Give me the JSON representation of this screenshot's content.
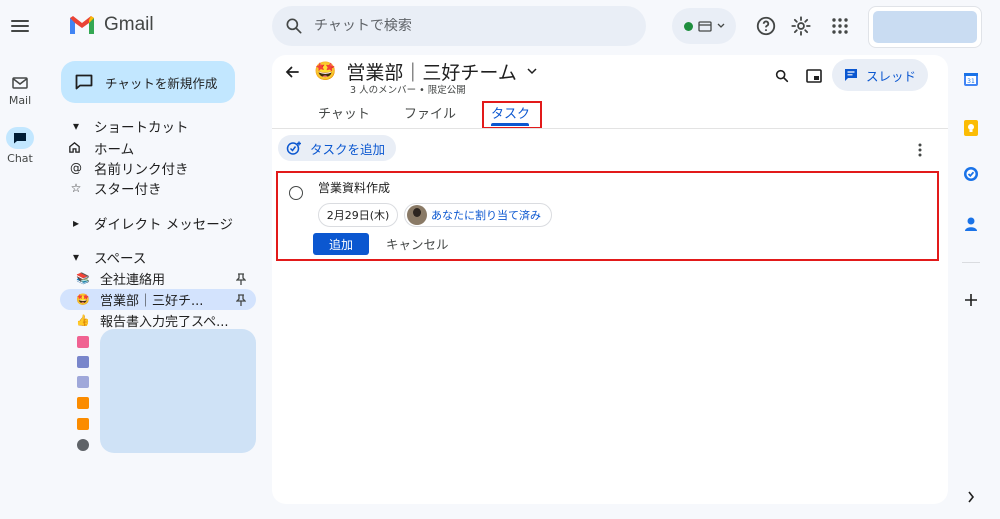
{
  "header": {
    "app_name": "Gmail",
    "search_placeholder": "チャットで検索"
  },
  "rail": {
    "mail_label": "Mail",
    "chat_label": "Chat"
  },
  "sidebar": {
    "new_chat_label": "チャットを新規作成",
    "shortcuts_label": "ショートカット",
    "shortcuts": [
      {
        "label": "ホーム",
        "icon": "home-icon"
      },
      {
        "label": "名前リンク付き",
        "icon": "at-icon"
      },
      {
        "label": "スター付き",
        "icon": "star-icon"
      }
    ],
    "direct_messages_label": "ダイレクト メッセージ",
    "spaces_label": "スペース",
    "spaces": [
      {
        "label": "全社連絡用",
        "emoji": "📚",
        "pinned": true
      },
      {
        "label": "営業部｜三好チ...",
        "emoji": "🤩",
        "pinned": true,
        "active": true
      },
      {
        "label": "報告書入力完了スペ...",
        "emoji": "👍",
        "pinned": false
      }
    ],
    "extra_space_colors": [
      "#f06292",
      "#7986cb",
      "#7986cb",
      "#fb8c00",
      "#fb8c00",
      "#5f6368"
    ]
  },
  "room": {
    "emoji": "🤩",
    "title": "営業部｜三好チーム",
    "subtitle": "3 人のメンバー • 限定公開",
    "thread_label": "スレッド",
    "tabs": [
      {
        "label": "チャット",
        "active": false
      },
      {
        "label": "ファイル",
        "active": false
      },
      {
        "label": "タスク",
        "active": true
      }
    ]
  },
  "tasks": {
    "add_task_label": "タスクを追加",
    "editing_task": {
      "title_value": "営業資料作成",
      "date_chip": "2月29日(木)",
      "assignee_chip": "あなたに割り当て済み",
      "add_button": "追加",
      "cancel_button": "キャンセル"
    }
  },
  "colors": {
    "accent": "#0b57d0",
    "highlight_box": "#e21a1a",
    "status_dot": "#1e8e3e"
  }
}
